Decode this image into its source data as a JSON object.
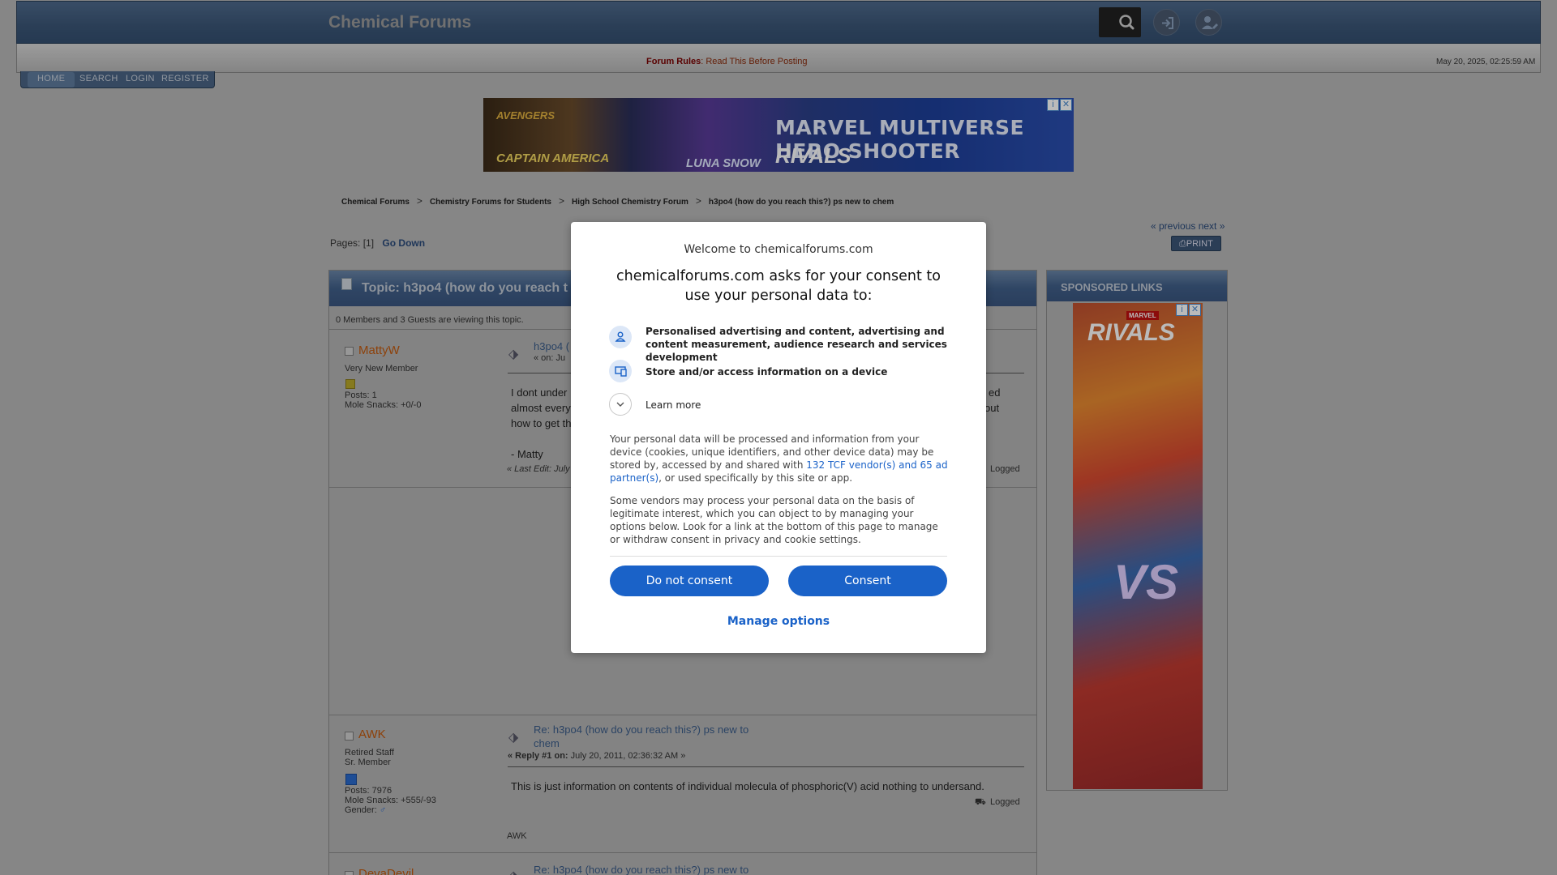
{
  "header": {
    "site_title": "Chemical Forums",
    "rules_label": "Forum Rules",
    "rules_text": ": Read This Before Posting",
    "datetime": "May 20, 2025, 02:25:59 AM"
  },
  "menu": {
    "home": "HOME",
    "search": "SEARCH",
    "login": "LOGIN",
    "register": "REGISTER"
  },
  "ad_banner": {
    "brand": "AVENGERS",
    "headline": "MARVEL MULTIVERSE HERO SHOOTER",
    "hero1": "CAPTAIN AMERICA",
    "hero2": "LUNA SNOW",
    "game": "RIVALS"
  },
  "breadcrumb": {
    "items": [
      "Chemical Forums",
      "Chemistry Forums for Students",
      "High School Chemistry Forum",
      "h3po4 (how do you reach this?) ps new to chem"
    ],
    "separator": ">"
  },
  "pagination": {
    "label": "Pages: [",
    "current": "1",
    "close": "]",
    "go_down": "Go Down",
    "prev_next": "« previous next »",
    "print": "PRINT"
  },
  "topic": {
    "title": "Topic: h3po4 (how do you reach t",
    "viewers": "0 Members and 3 Guests are viewing this topic."
  },
  "posts": [
    {
      "author": "MattyW",
      "rank": "Very New Member",
      "posts": "Posts: 1",
      "mole_snacks": "Mole Snacks: +0/-0",
      "subject": "h3po4 (",
      "on_label": "« on: Ju",
      "body_line1": "I dont under",
      "body_line1_end": "ed",
      "body_line2": "almost every",
      "body_line2_end": "out",
      "body_line3": "how to get th",
      "signature": "- Matty",
      "last_edit": "« Last Edit: July",
      "logged": "Logged"
    },
    {
      "author": "AWK",
      "rank": "Retired Staff",
      "rank2": "Sr. Member",
      "posts": "Posts: 7976",
      "mole_snacks": "Mole Snacks: +555/-93",
      "gender": "Gender:",
      "subject_line1": "Re: h3po4 (how do you reach this?) ps new to",
      "subject_line2": "chem",
      "reply_label": "« Reply #1 on:",
      "reply_date": "July 20, 2011, 02:36:32 AM »",
      "body": "This is just information on contents of individual molecula of phosphoric(V) acid nothing to undersand.",
      "logged": "Logged",
      "signature": "AWK"
    },
    {
      "author": "DevaDevil",
      "subject": "Re: h3po4 (how do you reach this?) ps new to"
    }
  ],
  "sponsored": {
    "title": "SPONSORED LINKS",
    "ad_brand": "MARVEL",
    "ad_game": "RIVALS",
    "ad_vs": "VS"
  },
  "consent": {
    "welcome": "Welcome to chemicalforums.com",
    "heading": "chemicalforums.com asks for your consent to use your personal data to:",
    "purpose1": "Personalised advertising and content, advertising and content measurement, audience research and services development",
    "purpose2": "Store and/or access information on a device",
    "learn_more": "Learn more",
    "para1_a": "Your personal data will be processed and information from your device (cookies, unique identifiers, and other device data) may be stored by, accessed by and shared with ",
    "para1_link": "132 TCF vendor(s) and 65 ad partner(s)",
    "para1_b": ", or used specifically by this site or app.",
    "para2": "Some vendors may process your personal data on the basis of legitimate interest, which you can object to by managing your options below. Look for a link at the bottom of this page to manage or withdraw consent in privacy and cookie settings.",
    "do_not_consent": "Do not consent",
    "consent": "Consent",
    "manage_options": "Manage options"
  }
}
